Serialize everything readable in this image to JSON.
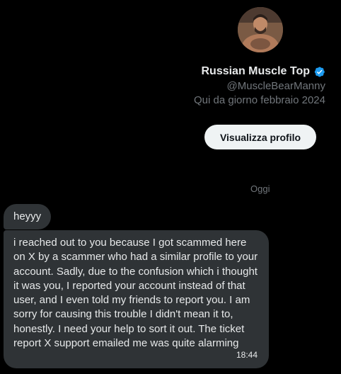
{
  "profile": {
    "display_name": "Russian Muscle Top",
    "handle": "@MuscleBearManny",
    "joined": "Qui da giorno febbraio 2024",
    "view_profile_label": "Visualizza profilo",
    "verified_color": "#1d9bf0"
  },
  "conversation": {
    "day_separator": "Oggi",
    "messages": [
      {
        "text": "heyyy",
        "time": ""
      },
      {
        "text": "i reached out to you because I got scammed here on X by a scammer who had a similar profile to your account. Sadly, due to the confusion which i thought it was you, I reported your account instead of that user, and I even told my friends to report you. I am sorry for causing this trouble I didn't mean it to, honestly. I need your help to sort it out. The ticket report X support emailed me was quite alarming",
        "time": "18:44"
      }
    ]
  },
  "colors": {
    "background": "#000000",
    "bubble": "#2f3336",
    "muted_text": "#71767b",
    "button_bg": "#eff3f4"
  }
}
